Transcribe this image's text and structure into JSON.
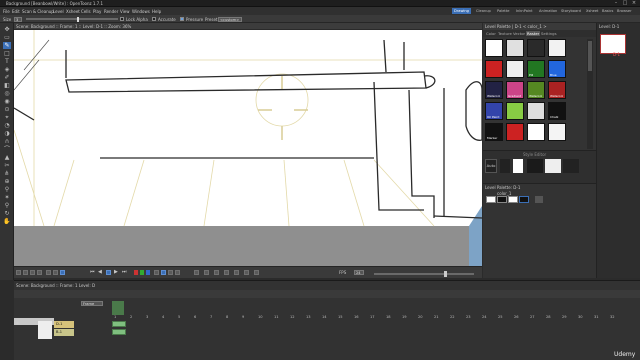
{
  "window": {
    "title": "Background [Beanbowl/Write] : OpenToonz 1.7.1",
    "controls": [
      "–",
      "□",
      "×"
    ]
  },
  "menubar": {
    "items": [
      "File",
      "Edit",
      "Scan & Cleanup",
      "Level",
      "Xsheet",
      "Cells",
      "Play",
      "Render",
      "View",
      "Windows",
      "Help"
    ],
    "rooms": [
      "Drawing",
      "Cleanup",
      "Palette",
      "InknPaint",
      "Animation",
      "Storyboard",
      "Xsheet",
      "Basics",
      "Browser"
    ],
    "active_room": "Drawing"
  },
  "tool_options": {
    "size_label": "Size",
    "size_value": "3",
    "lock_alpha": "Lock Alpha",
    "accurate": "Accurate",
    "pressure": "Pressure",
    "preset_label": "Preset",
    "preset_value": "<custom>"
  },
  "viewer": {
    "header": "Scene: Background  ::  Frame: 1  ::  Level: D-1  ::  Zoom: 36%",
    "fps_label": "FPS",
    "fps_value": "24"
  },
  "palette": {
    "header": "Level Palette | D-1  < color_1 >",
    "tabs": [
      "Color",
      "Texture",
      "Vector",
      "Raster",
      "Settings"
    ],
    "active_tab": "Raster",
    "swatches": [
      {
        "label": "",
        "color": "#ffffff"
      },
      {
        "label": "",
        "color": "#e0e0e0"
      },
      {
        "label": "",
        "color": "#2a2a2a"
      },
      {
        "label": "",
        "color": "#f2f2f2"
      },
      {
        "label": "",
        "color": "#cc2222"
      },
      {
        "label": "",
        "color": "#eeeeee"
      },
      {
        "label": "Pill",
        "color": "#227722"
      },
      {
        "label": "Blue",
        "color": "#2266dd"
      },
      {
        "label": "Watercol",
        "color": "#222244"
      },
      {
        "label": "Gradient",
        "color": "#cc4488"
      },
      {
        "label": "Watercol",
        "color": "#558822"
      },
      {
        "label": "Watercol",
        "color": "#aa2222"
      },
      {
        "label": "Oil Paint",
        "color": "#3344aa"
      },
      {
        "label": "",
        "color": "#88cc44"
      },
      {
        "label": "",
        "color": "#dddddd"
      },
      {
        "label": "Chalk",
        "color": "#111111"
      },
      {
        "label": "Marker",
        "color": "#111111"
      },
      {
        "label": "",
        "color": "#cc2222"
      },
      {
        "label": "",
        "color": "#ffffff"
      },
      {
        "label": "",
        "color": "#f4f4f4"
      }
    ],
    "style_editor_title": "Style Editor",
    "auto_label": "Auto"
  },
  "level_palette": {
    "title": "Level Palette: D-1",
    "name": "color_1"
  },
  "level_strip": {
    "title": "Level: D-1",
    "frame_label": "D-1"
  },
  "xsheet": {
    "header": "Scene: Background  ::  Frame: 1   Level: D",
    "frame_zoom": "Frame",
    "columns": [
      {
        "name": "Col1",
        "level": "D-1",
        "color": "#d6c27a"
      },
      {
        "name": "Col2",
        "level": "B-1",
        "color": "#c8c58a"
      }
    ],
    "frame_numbers": [
      "1",
      "2",
      "3",
      "4",
      "5",
      "6",
      "7",
      "8",
      "9",
      "10",
      "11",
      "12",
      "13",
      "14",
      "15",
      "16",
      "17",
      "18",
      "19",
      "20",
      "21",
      "22",
      "23",
      "24",
      "25",
      "26",
      "27",
      "28",
      "29",
      "30",
      "31",
      "32"
    ]
  },
  "watermark": "Udemy",
  "colors": {
    "accent": "#3b6fb6",
    "panel": "#333333",
    "canvas": "#ffffff"
  }
}
